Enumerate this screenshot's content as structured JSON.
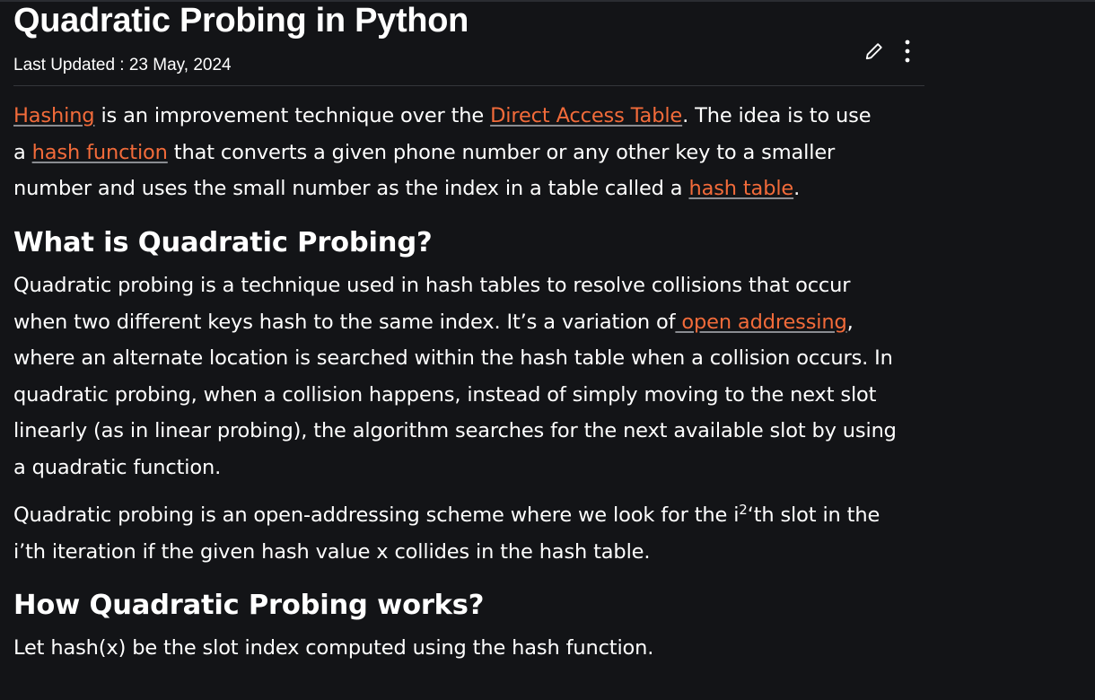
{
  "article": {
    "title": "Quadratic Probing in Python",
    "last_updated": "Last Updated : 23 May, 2024",
    "actions": {
      "edit_icon": "pencil-icon",
      "more_icon": "more-vertical-icon"
    },
    "intro": {
      "link_hashing": "Hashing",
      "t1": " is an improvement technique over the ",
      "link_direct": "Direct Access Table",
      "t2": ". The idea is to use",
      "t3": "a ",
      "link_hashfn": "hash function",
      "t4": " that converts a given phone number or any other key to a smaller",
      "t5": "number and uses the small number as the index in a table called a ",
      "link_hashtable": "hash table",
      "t6": "."
    },
    "section1": {
      "heading": "What is Quadratic Probing?",
      "p_a": "Quadratic probing is a technique used in hash tables to resolve collisions that occur",
      "p_b": "when two different keys hash to the same index. It’s a variation of",
      "link_open": " open addressing",
      "p_c": ",",
      "p_d": "where an alternate location is searched within the hash table when a collision occurs. In",
      "p_e": "quadratic probing, when a collision happens, instead of simply moving to the next slot",
      "p_f": "linearly (as in linear probing), the algorithm searches for the next available slot by using",
      "p_g": "a quadratic function.",
      "q_a": "Quadratic probing is an open-addressing scheme where we look for the i",
      "q_sup": "2",
      "q_b": "‘th slot in the",
      "q_c": "i’th iteration if the given hash value x collides in the hash table."
    },
    "section2": {
      "heading": "How Quadratic Probing works?",
      "p_a": "Let hash(x) be the slot index computed using the hash function."
    }
  },
  "colors": {
    "background": "#131417",
    "text": "#ffffff",
    "link": "#f26b3a",
    "divider": "#34363b"
  }
}
